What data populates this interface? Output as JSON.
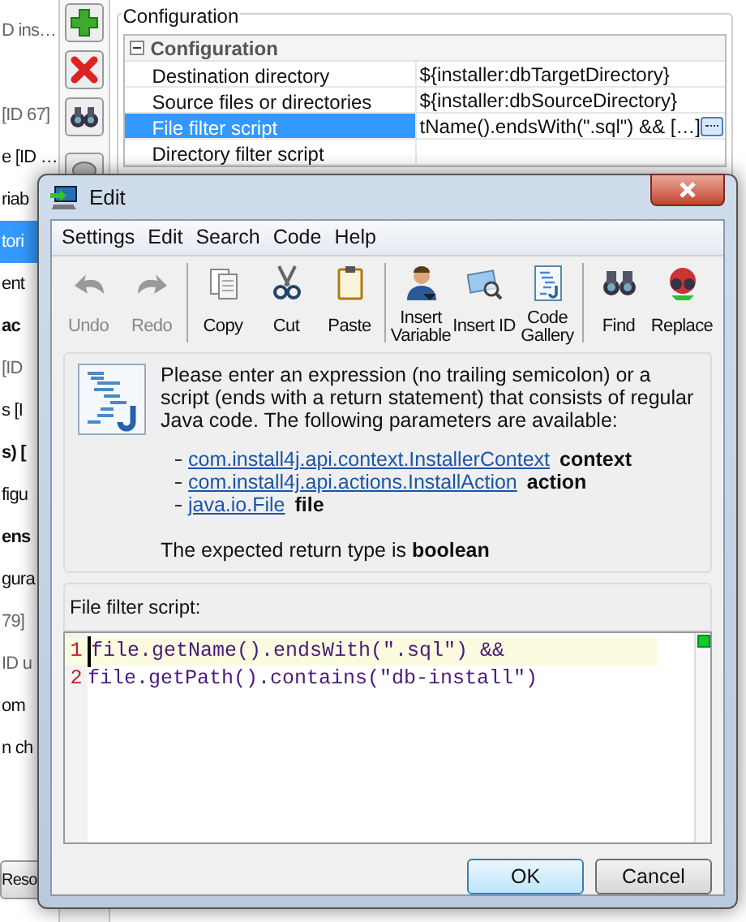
{
  "sidebar": {
    "items": [
      {
        "label": "D ins…",
        "kind": "muted",
        "selected": false
      },
      {
        "label": "[ID 67]",
        "kind": "muted",
        "selected": false
      },
      {
        "label": "e [ID …",
        "kind": "normal",
        "selected": false
      },
      {
        "label": "riab",
        "kind": "normal",
        "selected": false
      },
      {
        "label": "tori",
        "kind": "normal",
        "selected": true
      },
      {
        "label": "ent",
        "kind": "normal",
        "selected": false
      },
      {
        "label": "ac",
        "kind": "bold",
        "selected": false
      },
      {
        "label": "[ID",
        "kind": "muted",
        "selected": false
      },
      {
        "label": "s [I",
        "kind": "normal",
        "selected": false
      },
      {
        "label": "s) [",
        "kind": "bold",
        "selected": false
      },
      {
        "label": "figu",
        "kind": "normal",
        "selected": false
      },
      {
        "label": "ens",
        "kind": "bold",
        "selected": false
      },
      {
        "label": "gura",
        "kind": "normal",
        "selected": false
      },
      {
        "label": "79]",
        "kind": "muted",
        "selected": false
      },
      {
        "label": "ID u",
        "kind": "muted",
        "selected": false
      },
      {
        "label": "om",
        "kind": "normal",
        "selected": false
      },
      {
        "label": "n ch",
        "kind": "normal",
        "selected": false
      }
    ],
    "bottom_button": "Reso"
  },
  "configuration": {
    "title": "Configuration",
    "section": {
      "label": "Configuration",
      "expanded": true
    },
    "rows": [
      {
        "name": "Destination directory",
        "value": "${installer:dbTargetDirectory}",
        "selected": false,
        "has_button": false
      },
      {
        "name": "Source files or directories",
        "value": "${installer:dbSourceDirectory}",
        "selected": false,
        "has_button": false
      },
      {
        "name": "File filter script",
        "value": "tName().endsWith(\".sql\") && […]",
        "selected": true,
        "has_button": true
      },
      {
        "name": "Directory filter script",
        "selected": false,
        "has_button": false
      }
    ]
  },
  "dialog": {
    "title": "Edit",
    "menu": [
      "Settings",
      "Edit",
      "Search",
      "Code",
      "Help"
    ],
    "toolbar": [
      {
        "kind": "undo",
        "label": "Undo",
        "disabled": true,
        "separator_before": false
      },
      {
        "kind": "redo",
        "label": "Redo",
        "disabled": true,
        "separator_before": false
      },
      {
        "kind": "copy",
        "label": "Copy",
        "disabled": false,
        "separator_before": true
      },
      {
        "kind": "cut",
        "label": "Cut",
        "disabled": false,
        "separator_before": false
      },
      {
        "kind": "paste",
        "label": "Paste",
        "disabled": false,
        "separator_before": false
      },
      {
        "kind": "variable",
        "label": "Insert Variable",
        "disabled": false,
        "separator_before": true
      },
      {
        "kind": "id",
        "label": "Insert ID",
        "disabled": false,
        "separator_before": false
      },
      {
        "kind": "gallery",
        "label": "Code Gallery",
        "disabled": false,
        "separator_before": false
      },
      {
        "kind": "find",
        "label": "Find",
        "disabled": false,
        "separator_before": true
      },
      {
        "kind": "replace",
        "label": "Replace",
        "disabled": false,
        "separator_before": false
      }
    ],
    "description": "Please enter an expression (no trailing semicolon) or a script (ends with a return statement) that consists of regular Java code. The following parameters are available:",
    "parameters": [
      {
        "type": "com.install4j.api.context.InstallerContext",
        "name": "context"
      },
      {
        "type": "com.install4j.api.actions.InstallAction",
        "name": "action"
      },
      {
        "type": "java.io.File",
        "name": "file"
      }
    ],
    "return_note": "The expected return type is **boolean**",
    "editor_label": "File filter script:",
    "code_lines": [
      {
        "number": "1",
        "text": "file.getName().endsWith(\".sql\") &&",
        "current": true
      },
      {
        "number": "2",
        "text": "file.getPath().contains(\"db-install\")",
        "current": false
      }
    ],
    "buttons": [
      {
        "label": "OK",
        "default": true
      },
      {
        "label": "Cancel",
        "default": false
      }
    ]
  }
}
